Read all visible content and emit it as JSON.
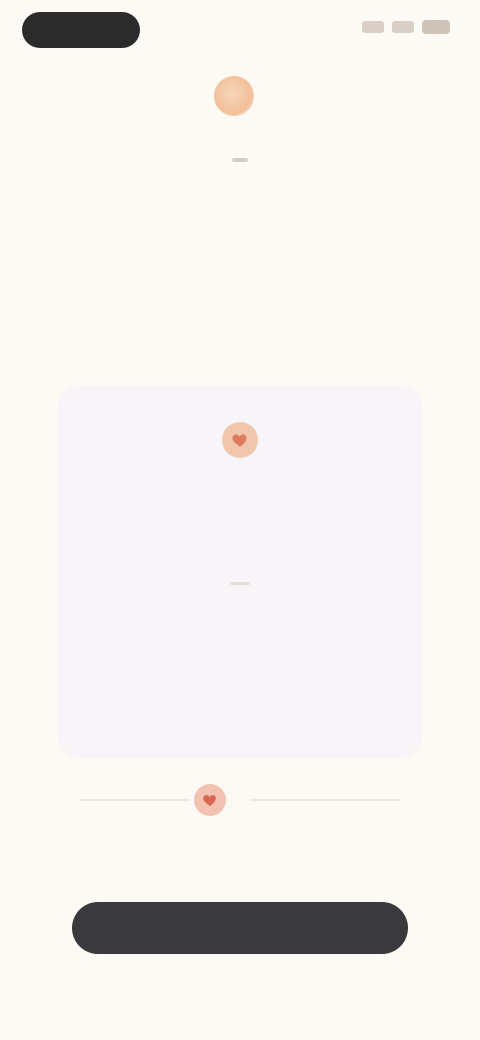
{
  "status_bar": {
    "time": "",
    "icons": [
      "signal-icon",
      "wifi-icon",
      "battery-icon"
    ]
  },
  "brand": {
    "name": "",
    "logo_icon": "brand-logo-icon"
  },
  "onboarding": {
    "eyebrow": [
      "",
      "",
      "",
      "",
      "",
      ""
    ],
    "headline": "",
    "subtext": ""
  },
  "card": {
    "icon": "heart-icon",
    "title": "",
    "body": "",
    "subtitle": "",
    "body2": ""
  },
  "divider": {
    "badge_icon": "heart-icon"
  },
  "actions": {
    "primary_label": "",
    "secondary_label": ""
  },
  "colors": {
    "background": "#fdfaf5",
    "accent": "#e07a5f",
    "button": "#3a393b",
    "card": "#f7f5f8"
  }
}
